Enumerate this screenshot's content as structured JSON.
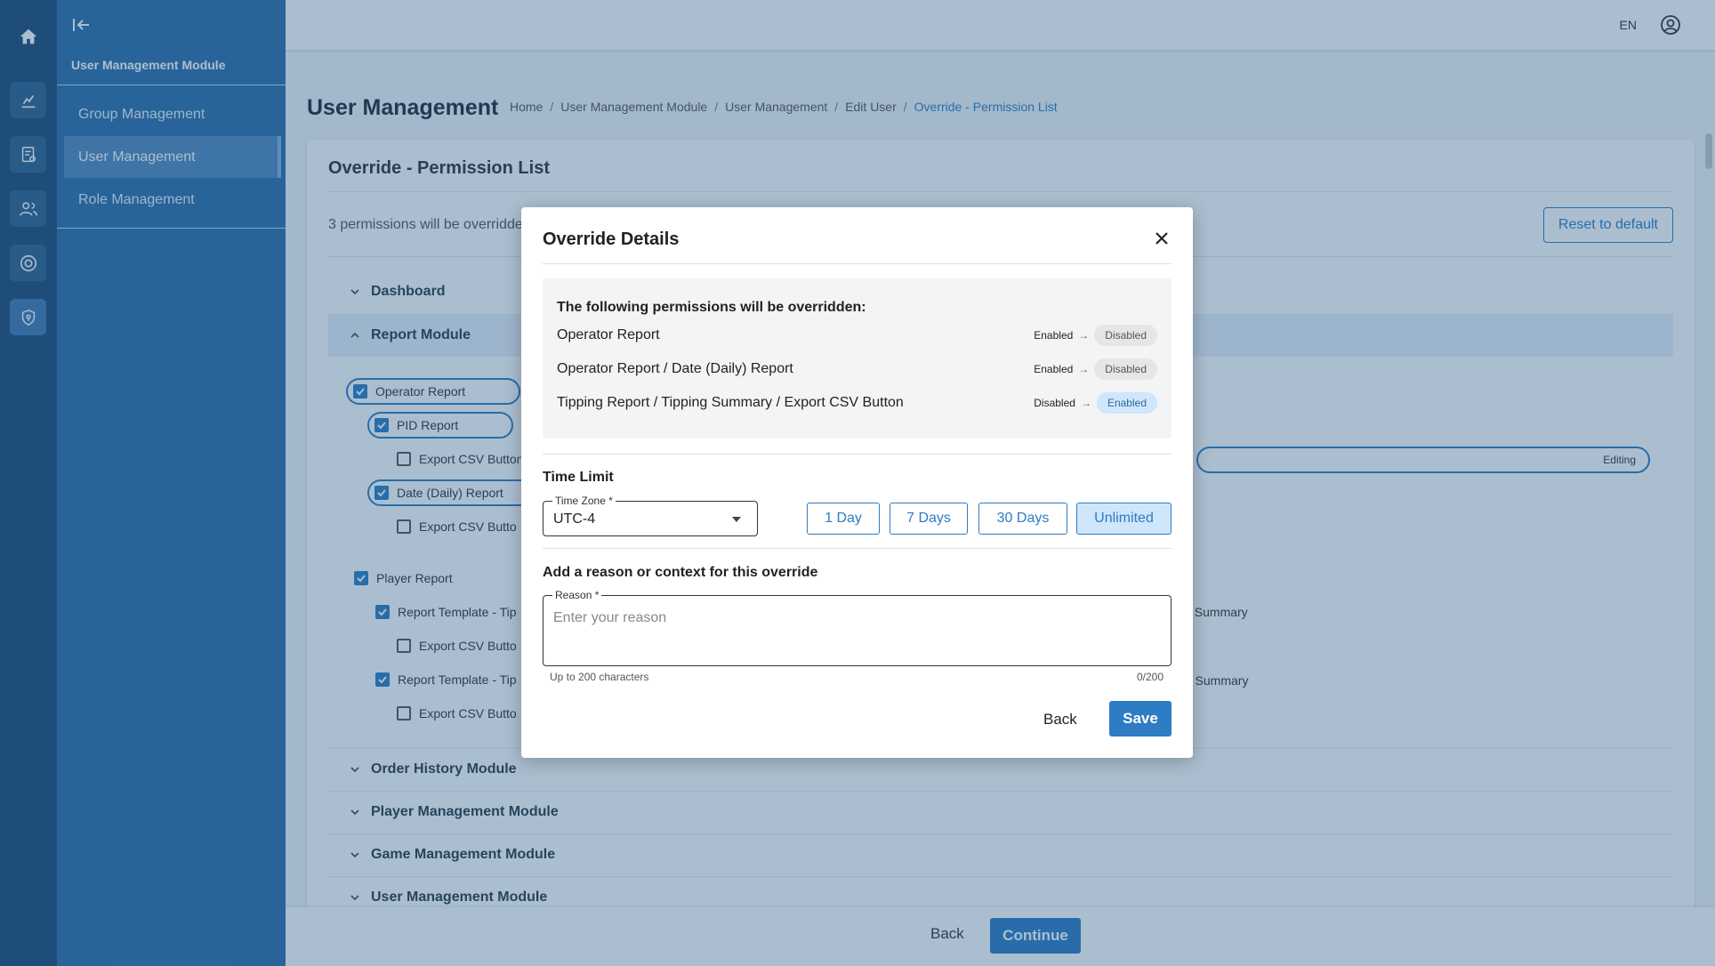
{
  "app": {
    "sidebar_module_title": "User Management Module",
    "sidebar_items": [
      "Group Management",
      "User Management",
      "Role Management"
    ],
    "language": "EN",
    "rail_icons": [
      "home-icon",
      "chart-icon",
      "report-icon",
      "users-icon",
      "target-icon",
      "shield-icon"
    ]
  },
  "page": {
    "title": "User Management",
    "breadcrumb": [
      "Home",
      "User Management Module",
      "User Management",
      "Edit User",
      "Override - Permission List"
    ]
  },
  "card": {
    "title": "Override - Permission List",
    "summary": "3 permissions will be overridde",
    "reset_label": "Reset to default",
    "sections": [
      "Dashboard",
      "Report Module",
      "Order History Module",
      "Player Management Module",
      "Game Management Module",
      "User Management Module"
    ],
    "tree": {
      "operator_report": "Operator Report",
      "pid_report": "PID Report",
      "export_csv": "Export CSV Button",
      "export_csv_trunc": "Export CSV Butto",
      "date_daily": "Date (Daily) Report",
      "player_report": "Player Report",
      "report_template_tip": "Report Template  - Tip",
      "right_1": "t Summary",
      "right_2": "r Summary",
      "editing": "Editing"
    }
  },
  "footer": {
    "back": "Back",
    "continue": "Continue"
  },
  "modal": {
    "title": "Override Details",
    "perm_heading": "The following permissions will be overridden:",
    "permissions": [
      {
        "name": "Operator Report",
        "from": "Enabled",
        "to": "Disabled"
      },
      {
        "name": "Operator Report / Date (Daily) Report",
        "from": "Enabled",
        "to": "Disabled"
      },
      {
        "name": "Tipping Report / Tipping Summary / Export CSV Button",
        "from": "Disabled",
        "to": "Enabled"
      }
    ],
    "arrow": "→",
    "time_limit_label": "Time Limit",
    "time_zone_label": "Time Zone *",
    "time_zone_value": "UTC-4",
    "time_limit_options": [
      "1 Day",
      "7 Days",
      "30 Days",
      "Unlimited"
    ],
    "time_limit_selected": "Unlimited",
    "reason_section": "Add a reason or context for this override",
    "reason_label": "Reason *",
    "reason_placeholder": "Enter your reason",
    "reason_helper": "Up to 200 characters",
    "reason_counter": "0/200",
    "back": "Back",
    "save": "Save"
  },
  "colors": {
    "primary": "#2d7cc4",
    "sidebar": "#2c6ea8",
    "rail": "#1e4a76"
  }
}
